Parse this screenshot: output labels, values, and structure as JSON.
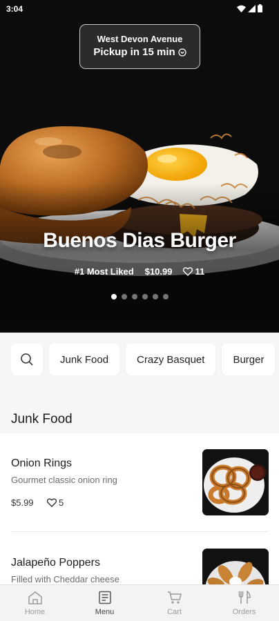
{
  "status_bar": {
    "time": "3:04",
    "icons": [
      "wifi-icon",
      "signal-icon",
      "battery-icon"
    ]
  },
  "location": {
    "name": "West Devon Avenue",
    "pickup": "Pickup in 15 min",
    "icon": "chevron-circle-icon"
  },
  "hero": {
    "title": "Buenos Dias Burger",
    "badge": "#1 Most Liked",
    "price": "$10.99",
    "likes": "11",
    "slide_count": 6,
    "active_slide": 1
  },
  "chips": [
    "Junk Food",
    "Crazy Basquet",
    "Burger"
  ],
  "section": {
    "title": "Junk Food"
  },
  "items": [
    {
      "name": "Onion Rings",
      "description": "Gourmet classic onion ring",
      "price": "$5.99",
      "likes": "5"
    },
    {
      "name": "Jalapeño Poppers",
      "description": "Filled with Cheddar cheese",
      "price": "",
      "likes": ""
    }
  ],
  "nav": [
    {
      "label": "Home",
      "icon": "home-icon"
    },
    {
      "label": "Menu",
      "icon": "menu-book-icon",
      "active": true
    },
    {
      "label": "Cart",
      "icon": "cart-icon"
    },
    {
      "label": "Orders",
      "icon": "utensils-icon"
    }
  ],
  "colors": {
    "hero_bg": "#0c0c0c",
    "page_bg": "#f6f6f6",
    "active_nav": "#444444",
    "inactive_nav": "#9a9a9a"
  }
}
